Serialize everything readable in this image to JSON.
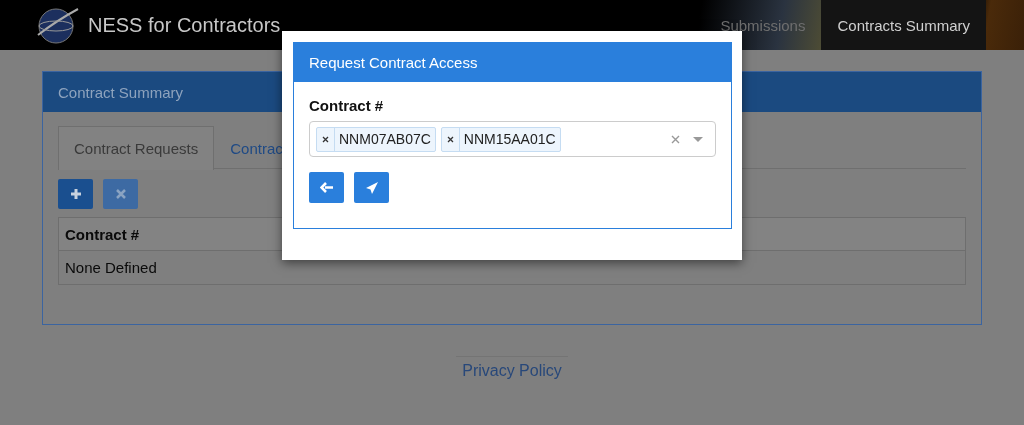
{
  "navbar": {
    "title": "NESS for Contractors",
    "items": [
      {
        "label": "Submissions",
        "selected": false
      },
      {
        "label": "Contracts Summary",
        "selected": true
      }
    ]
  },
  "card": {
    "title": "Contract Summary",
    "tabs": [
      {
        "label": "Contract Requests",
        "selected": true
      },
      {
        "label": "Contrac",
        "selected": false
      }
    ],
    "toolbar": [
      {
        "kind": "add",
        "disabled": false
      },
      {
        "kind": "remove",
        "disabled": true
      }
    ],
    "table": {
      "columns": [
        "Contract #"
      ],
      "rows": [
        [
          "None Defined"
        ]
      ]
    }
  },
  "footer": {
    "link": "Privacy Policy"
  },
  "modal": {
    "title": "Request Contract Access",
    "label": "Contract #",
    "tags": [
      "NNM07AB07C",
      "NNM15AA01C"
    ],
    "buttons": [
      {
        "kind": "back"
      },
      {
        "kind": "send"
      }
    ]
  }
}
